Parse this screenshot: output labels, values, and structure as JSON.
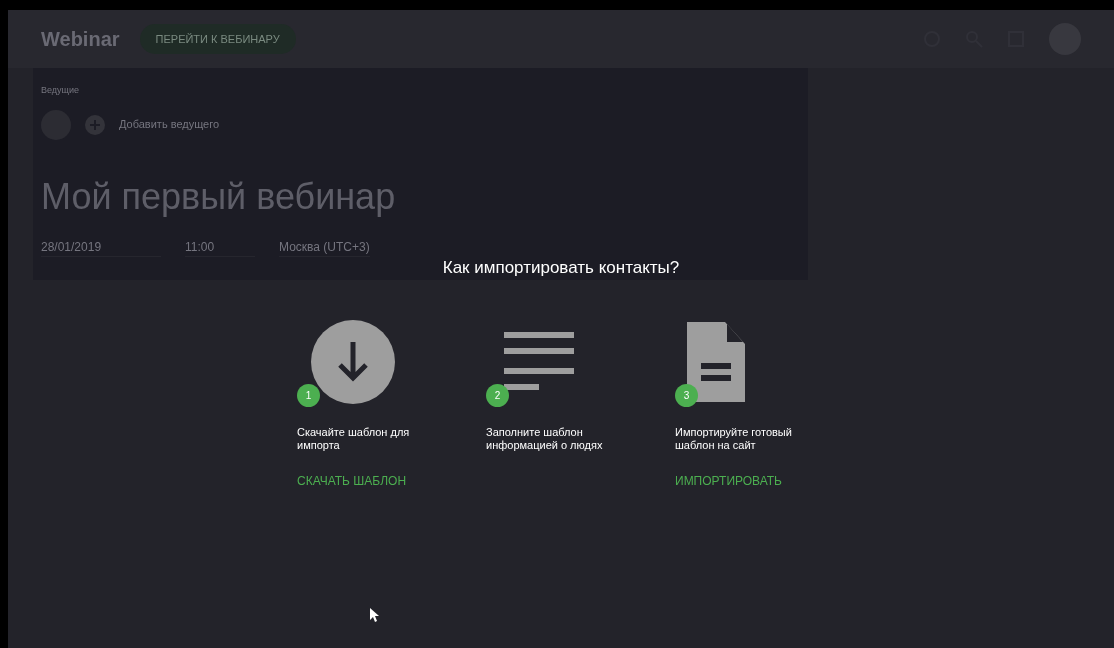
{
  "header": {
    "logo": "Webinar",
    "go_button": "ПЕРЕЙТИ К ВЕБИНАРУ"
  },
  "event": {
    "hosts_label": "Ведущие",
    "add_host": "Добавить ведущего",
    "title": "Мой первый вебинар",
    "date": "28/01/2019",
    "time": "11:00",
    "timezone": "Москва (UTC+3)"
  },
  "dialog": {
    "title": "Как импортировать контакты?",
    "steps": [
      {
        "kind": "download",
        "number": "1",
        "text": "Скачайте шаблон для импорта",
        "link": "СКАЧАТЬ ШАБЛОН"
      },
      {
        "kind": "list",
        "number": "2",
        "text": "Заполните шаблон информацией о людях"
      },
      {
        "kind": "document",
        "number": "3",
        "text": "Импортируйте готовый шаблон на сайт",
        "link": "ИМПОРТИРОВАТЬ"
      }
    ]
  }
}
